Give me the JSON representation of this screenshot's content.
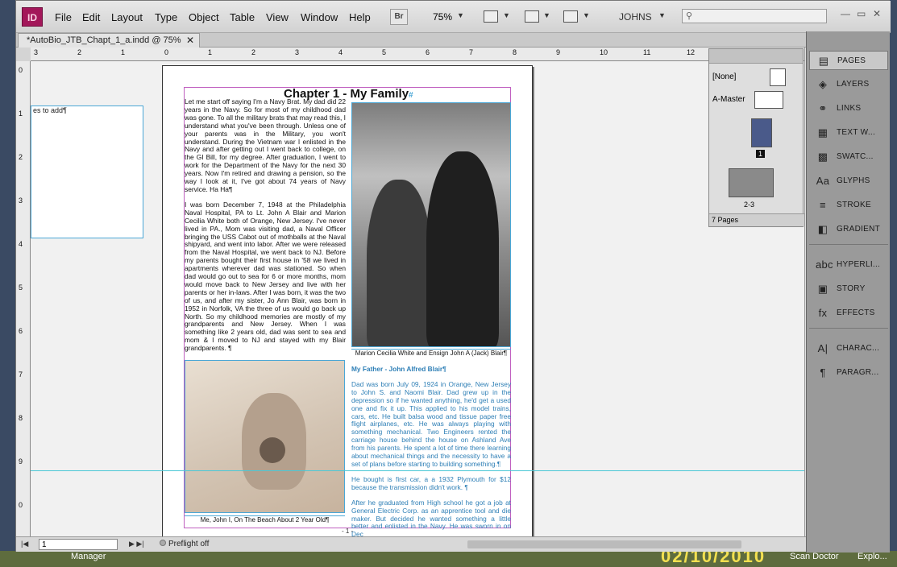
{
  "menubar": {
    "logo": "ID",
    "items": [
      "File",
      "Edit",
      "Layout",
      "Type",
      "Object",
      "Table",
      "View",
      "Window",
      "Help"
    ],
    "bridge_label": "Br",
    "zoom": "75%",
    "workspace": "JOHNS",
    "search_placeholder": ""
  },
  "document": {
    "tab_title": "*AutoBio_JTB_Chapt_1_a.indd @ 75%",
    "chapter_title": "Chapter 1 - My Family",
    "paragraphs_left": [
      "Let me start off saying I'm a Navy Brat.  My dad did 22 years in the Navy.  So for most of my childhood dad was gone.  To all the military brats that may read this, I understand what you've been through.  Unless one of your parents was in the Military, you won't understand. During the Vietnam war I enlisted in the Navy and after getting out I went back to college, on the GI Bill, for my degree.  After graduation, I went to work for the Department of the Navy for the next 30 years.  Now I'm retired and drawing a pension, so the way I look at it, I've got about 74 years of Navy service.  Ha Ha¶",
      "I was born December 7, 1948 at the Philadelphia Naval Hospital, PA to Lt. John A Blair and Marion Cecilia White both of Orange, New Jersey.  I've never lived in PA., Mom was visiting dad, a Naval Officer bringing the USS Cabot out of mothballs at the Naval shipyard, and went into labor.  After we were released from the Naval Hospital, we went back to NJ.  Before my parents bought their first house in '58 we lived in apartments wherever dad was stationed.  So when dad would go out to sea for 6 or more months, mom would move back to New Jersey and live with her parents or her in-laws.  After I was born, it was the two of us, and after my sister, Jo Ann Blair, was born in 1952 in Norfolk, VA the three of us would go back up North.  So my childhood memories are mostly of my grandparents and New Jersey.  When I was something like 2 years old, dad was sent to sea and mom & I moved to NJ and stayed with my Blair grandparents. ¶"
    ],
    "caption_top": "Marion Cecilia White and Ensign John A (Jack) Blair¶",
    "caption_bottom": "Me, John I, On The Beach About 2 Year Old¶",
    "right_heading": "My Father - John Alfred Blair¶",
    "paragraphs_right": [
      "Dad was born  July 09, 1924 in Orange, New Jersey to John S. and Naomi Blair.  Dad grew up in the depression so if he wanted anything, he'd get a used one and fix it up.  This applied to his model trains, cars, etc.  He built balsa wood and tissue paper free flight airplanes, etc.  He was always playing with something mechanical.  Two Engineers rented the carriage house behind the house on Ashland Ave from his parents.  He spent a lot of time there learning about mechanical things and the necessity to have a set of plans before starting to building something.¶",
      "He bought is first car, a a 1932 Plymouth for $12 because the transmission didn't work. ¶",
      "After he graduated from High school he got a job at General Electric Corp. as an apprentice tool and die maker.  But decided he wanted something a little better and enlisted in the Navy.  He was sworn in on Dec"
    ],
    "page_number": "- 1 -",
    "sidebox_text": "es to add¶"
  },
  "rulers": {
    "h": [
      "3",
      "2",
      "1",
      "0",
      "1",
      "2",
      "3",
      "4",
      "5",
      "6",
      "7",
      "8",
      "9",
      "10",
      "11",
      "12"
    ],
    "v": [
      "0",
      "1",
      "2",
      "3",
      "4",
      "5",
      "6",
      "7",
      "8",
      "9",
      "0"
    ]
  },
  "status": {
    "page_field": "1",
    "preflight": "Preflight off"
  },
  "pages_panel": {
    "none_label": "[None]",
    "master_label": "A-Master",
    "page1_label": "1",
    "spread_label": "2-3",
    "count": "7 Pages"
  },
  "dock": [
    {
      "label": "PAGES",
      "icon": "pages-icon"
    },
    {
      "label": "LAYERS",
      "icon": "layers-icon"
    },
    {
      "label": "LINKS",
      "icon": "links-icon"
    },
    {
      "label": "TEXT W...",
      "icon": "text-wrap-icon"
    },
    {
      "label": "SWATC...",
      "icon": "swatches-icon"
    },
    {
      "label": "GLYPHS",
      "icon": "glyphs-icon"
    },
    {
      "label": "STROKE",
      "icon": "stroke-icon"
    },
    {
      "label": "GRADIENT",
      "icon": "gradient-icon"
    },
    {
      "label": "HYPERLI...",
      "icon": "hyperlinks-icon"
    },
    {
      "label": "STORY",
      "icon": "story-icon"
    },
    {
      "label": "EFFECTS",
      "icon": "effects-icon"
    },
    {
      "label": "CHARAC...",
      "icon": "character-icon"
    },
    {
      "label": "PARAGR...",
      "icon": "paragraph-icon"
    }
  ],
  "taskbar": {
    "left": "Manager",
    "right1": "Scan Doctor",
    "right2": "Explo...",
    "date": "02/10/2010"
  }
}
